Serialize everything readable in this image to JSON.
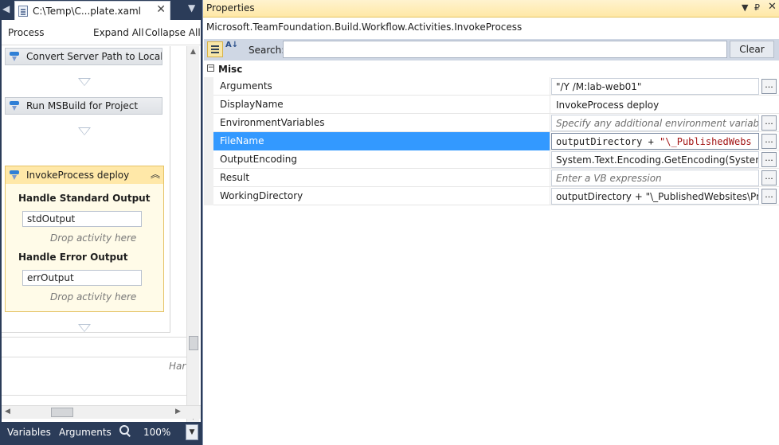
{
  "document": {
    "tab_title": "C:\\Temp\\C...plate.xaml",
    "tab_close": "✕",
    "tab_left": "◀",
    "tab_menu": "▼"
  },
  "breadcrumb": {
    "root": "Process",
    "expand_all": "Expand All",
    "collapse_all": "Collapse All"
  },
  "activities": [
    {
      "label": "Convert Server Path to Local"
    },
    {
      "label": "Run MSBuild for Project"
    }
  ],
  "invoke_process": {
    "label": "InvokeProcess deploy",
    "collapse_glyph": "︽",
    "standard_output": {
      "title": "Handle Standard Output",
      "variable": "stdOutput",
      "drop_hint": "Drop activity here"
    },
    "error_output": {
      "title": "Handle Error Output",
      "variable": "errOutput",
      "drop_hint": "Drop activity here"
    }
  },
  "lower_hint": "Har",
  "footer": {
    "variables": "Variables",
    "arguments": "Arguments",
    "zoom": "100%",
    "zoom_dropdown": "▼"
  },
  "properties": {
    "title": "Properties",
    "title_controls": {
      "dropdown": "▼",
      "pin": "₽",
      "close": "✕"
    },
    "type_name": "Microsoft.TeamFoundation.Build.Workflow.Activities.InvokeProcess",
    "search_label": "Search:",
    "search_value": "",
    "clear_label": "Clear",
    "alpha_glyph": "A↓",
    "category": {
      "toggle": "−",
      "name": "Misc"
    },
    "rows": [
      {
        "name": "Arguments",
        "value": "\"/Y /M:lab-web01\"",
        "button": "..."
      },
      {
        "name": "DisplayName",
        "value": "InvokeProcess deploy"
      },
      {
        "name": "EnvironmentVariables",
        "value": "Specify any additional environment variables and",
        "button": "..."
      },
      {
        "name": "FileName",
        "value_code": "outputDirectory + ",
        "value_str": "\"\\_PublishedWebs",
        "button": "..."
      },
      {
        "name": "OutputEncoding",
        "value": "System.Text.Encoding.GetEncoding(System.Glob",
        "button": "..."
      },
      {
        "name": "Result",
        "value": "Enter a VB expression",
        "button": "..."
      },
      {
        "name": "WorkingDirectory",
        "value": "outputDirectory + \"\\_PublishedWebsites\\Provid",
        "button": "..."
      }
    ]
  },
  "colors": {
    "chrome": "#2b3c59",
    "selection": "#3399ff",
    "activity_highlight": "#ffe8a8"
  }
}
